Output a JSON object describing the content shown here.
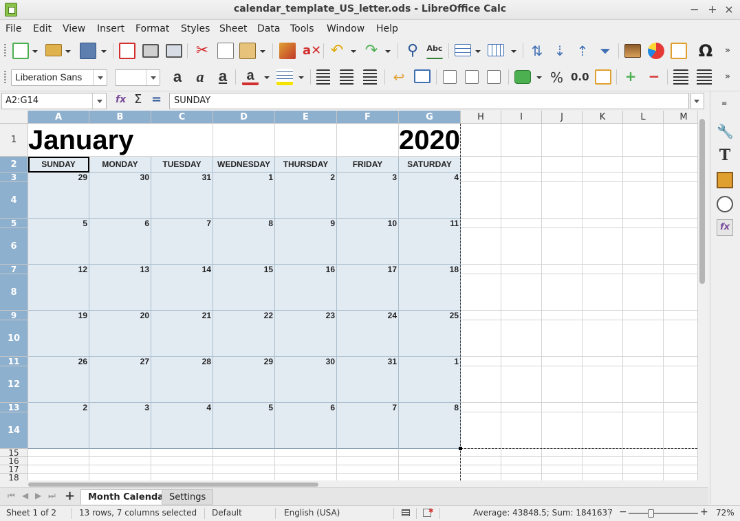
{
  "window": {
    "title": "calendar_template_US_letter.ods - LibreOffice Calc"
  },
  "menu": [
    "File",
    "Edit",
    "View",
    "Insert",
    "Format",
    "Styles",
    "Sheet",
    "Data",
    "Tools",
    "Window",
    "Help"
  ],
  "format_toolbar": {
    "font_name": "Liberation Sans",
    "font_size": "",
    "percent_label": "%",
    "decimal_label": "0.0"
  },
  "formula_bar": {
    "name_box": "A2:G14",
    "input": "SUNDAY"
  },
  "columns": [
    "A",
    "B",
    "C",
    "D",
    "E",
    "F",
    "G",
    "H",
    "I",
    "J",
    "K",
    "L",
    "M"
  ],
  "rows": [
    "1",
    "2",
    "3",
    "4",
    "5",
    "6",
    "7",
    "8",
    "9",
    "10",
    "11",
    "12",
    "13",
    "14",
    "15",
    "16",
    "17",
    "18"
  ],
  "calendar": {
    "month": "January",
    "year": "2020",
    "day_headers": [
      "SUNDAY",
      "MONDAY",
      "TUESDAY",
      "WEDNESDAY",
      "THURSDAY",
      "FRIDAY",
      "SATURDAY"
    ],
    "weeks": [
      [
        "29",
        "30",
        "31",
        "1",
        "2",
        "3",
        "4"
      ],
      [
        "5",
        "6",
        "7",
        "8",
        "9",
        "10",
        "11"
      ],
      [
        "12",
        "13",
        "14",
        "15",
        "16",
        "17",
        "18"
      ],
      [
        "19",
        "20",
        "21",
        "22",
        "23",
        "24",
        "25"
      ],
      [
        "26",
        "27",
        "28",
        "29",
        "30",
        "31",
        "1"
      ],
      [
        "2",
        "3",
        "4",
        "5",
        "6",
        "7",
        "8"
      ]
    ]
  },
  "tabs": [
    {
      "label": "Month Calendar",
      "active": true
    },
    {
      "label": "Settings",
      "active": false
    }
  ],
  "status": {
    "sheet": "Sheet 1 of 2",
    "selection": "13 rows, 7 columns selected",
    "style": "Default",
    "language": "English (USA)",
    "stats": "Average: 43848.5; Sum: 1841637",
    "zoom": "72%"
  },
  "colors": {
    "selection_header": "#8eb0cf",
    "selection_fill": "#e2eaf2",
    "app_green": "#8bc34a"
  }
}
